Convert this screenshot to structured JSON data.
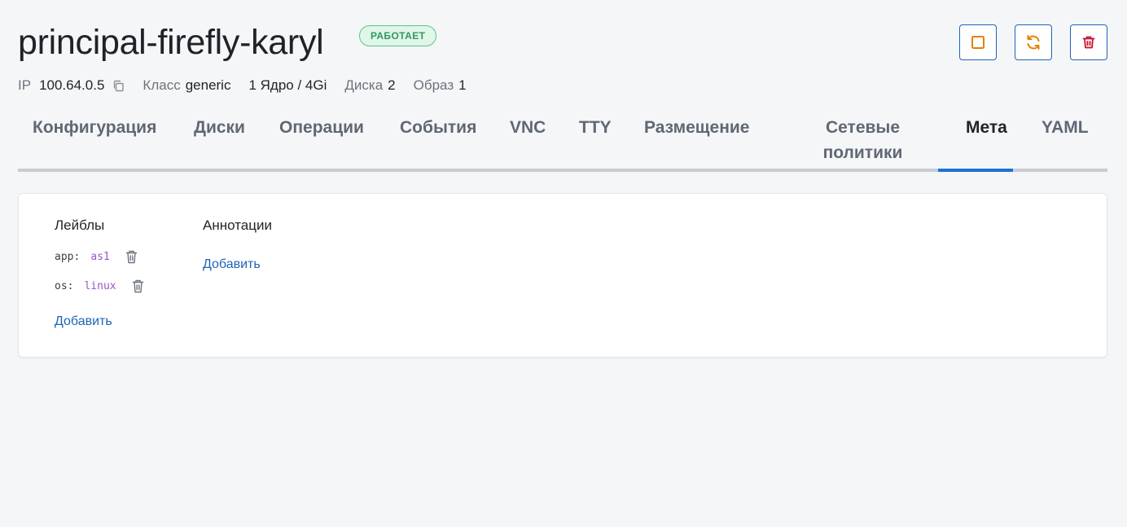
{
  "header": {
    "title": "principal-firefly-karyl",
    "status": "РАБОТАЕТ",
    "status_color": "#2f9a5e",
    "actions": [
      {
        "icon": "stop-icon",
        "color": "#e67e00"
      },
      {
        "icon": "restart-icon",
        "color": "#e67e00"
      },
      {
        "icon": "trash-icon",
        "color": "#c8102e"
      }
    ]
  },
  "meta": {
    "ip_label": "IP",
    "ip_value": "100.64.0.5",
    "class_label": "Класс",
    "class_value": "generic",
    "resources": "1 Ядро / 4Gi",
    "disks_label": "Диска",
    "disks_value": "2",
    "images_label": "Образ",
    "images_value": "1"
  },
  "tabs": [
    {
      "label": "Конфигурация"
    },
    {
      "label": "Диски"
    },
    {
      "label": "Операции"
    },
    {
      "label": "События"
    },
    {
      "label": "VNC"
    },
    {
      "label": "TTY"
    },
    {
      "label": "Размещение"
    },
    {
      "label": "Сетевые политики"
    },
    {
      "label": "Мета"
    },
    {
      "label": "YAML"
    }
  ],
  "active_tab": "Мета",
  "accent_color": "#1f6fd6",
  "labels": {
    "title": "Лейблы",
    "items": [
      {
        "key": "app:",
        "value": "as1"
      },
      {
        "key": "os:",
        "value": "linux"
      }
    ],
    "add": "Добавить"
  },
  "annotations": {
    "title": "Аннотации",
    "add": "Добавить"
  }
}
